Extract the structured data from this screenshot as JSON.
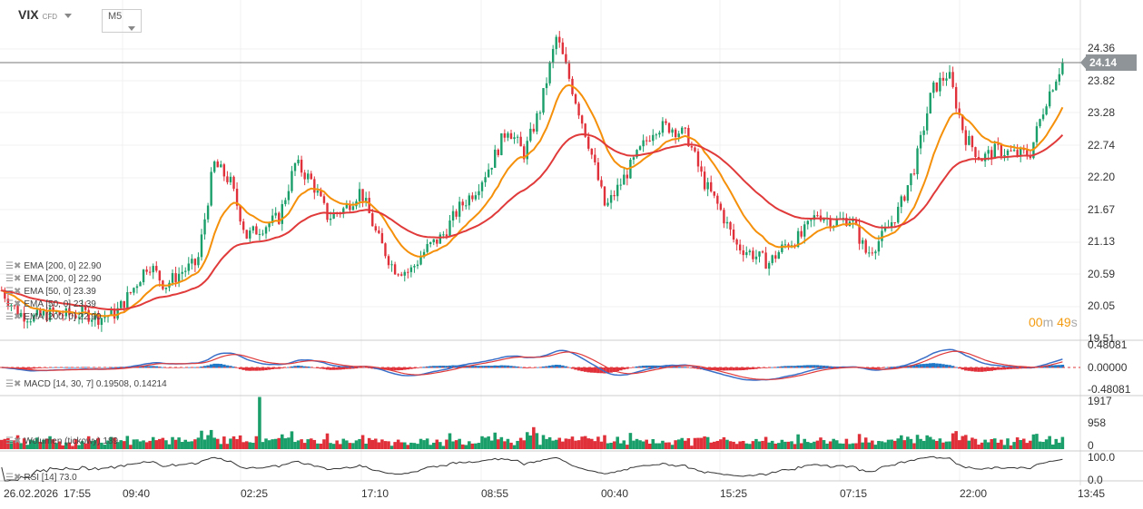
{
  "header": {
    "symbol": "VIX",
    "symbol_type": "CFD",
    "timeframe": "M5"
  },
  "price_axis": {
    "ticks": [
      "24.36",
      "23.82",
      "23.28",
      "22.74",
      "22.20",
      "21.67",
      "21.13",
      "20.59",
      "20.05",
      "19.51"
    ],
    "current_price": "24.14",
    "countdown_min": "00",
    "countdown_min_unit": "m",
    "countdown_sec": "49",
    "countdown_sec_unit": "s"
  },
  "indicators": {
    "price_legends": [
      "EMA [200, 0] 22.90",
      "EMA [200, 0] 22.90",
      "EMA [50, 0] 23.39",
      "EMA [50, 0] 23.39",
      "EMA [200, 0] 22.90"
    ],
    "macd": {
      "label": "MACD [14, 30, 7] 0.19508, 0.14214",
      "ticks": [
        "0.48081",
        "0.00000",
        "-0.48081"
      ]
    },
    "volume": {
      "label": "Wolumen (tickowy) 189",
      "ticks": [
        "1917",
        "958",
        "0"
      ]
    },
    "rsi": {
      "label": "RSI [14] 73.0",
      "ticks": [
        "100.0",
        "0.0"
      ]
    }
  },
  "x_axis": {
    "labels": [
      "26.02.2026",
      "17:55",
      "09:40",
      "02:25",
      "17:10",
      "08:55",
      "00:40",
      "15:25",
      "07:15",
      "22:00",
      "13:45"
    ]
  },
  "colors": {
    "up": "#1a9e6a",
    "down": "#e0303a",
    "ema50": "#f5900a",
    "ema200": "#e03a3a",
    "macd": "#3a6fc8",
    "signal": "#e03a3a"
  },
  "chart_data": {
    "type": "candlestick",
    "ylim": [
      19.51,
      24.36
    ],
    "closes": [
      20.31,
      19.93,
      19.85,
      19.93,
      19.89,
      19.93,
      19.85,
      19.93,
      20.31,
      20.77,
      20.39,
      20.62,
      20.77,
      22.44,
      22.14,
      21.22,
      21.38,
      21.53,
      22.44,
      22.14,
      21.53,
      21.68,
      21.99,
      21.22,
      20.69,
      20.62,
      21.0,
      21.22,
      21.68,
      21.99,
      22.44,
      23.05,
      22.6,
      23.36,
      24.57,
      23.66,
      22.75,
      21.68,
      22.14,
      22.6,
      23.05,
      23.05,
      22.9,
      22.14,
      21.68,
      21.07,
      20.92,
      20.77,
      21.07,
      21.22,
      21.61,
      21.45,
      21.53,
      20.92,
      21.22,
      21.68,
      22.44,
      23.66,
      23.96,
      22.9,
      22.52,
      22.67,
      22.6,
      22.6,
      23.51,
      24.14
    ],
    "series": [
      {
        "name": "EMA [50, 0]",
        "last": 23.39
      },
      {
        "name": "EMA [200, 0]",
        "last": 22.9
      }
    ]
  }
}
